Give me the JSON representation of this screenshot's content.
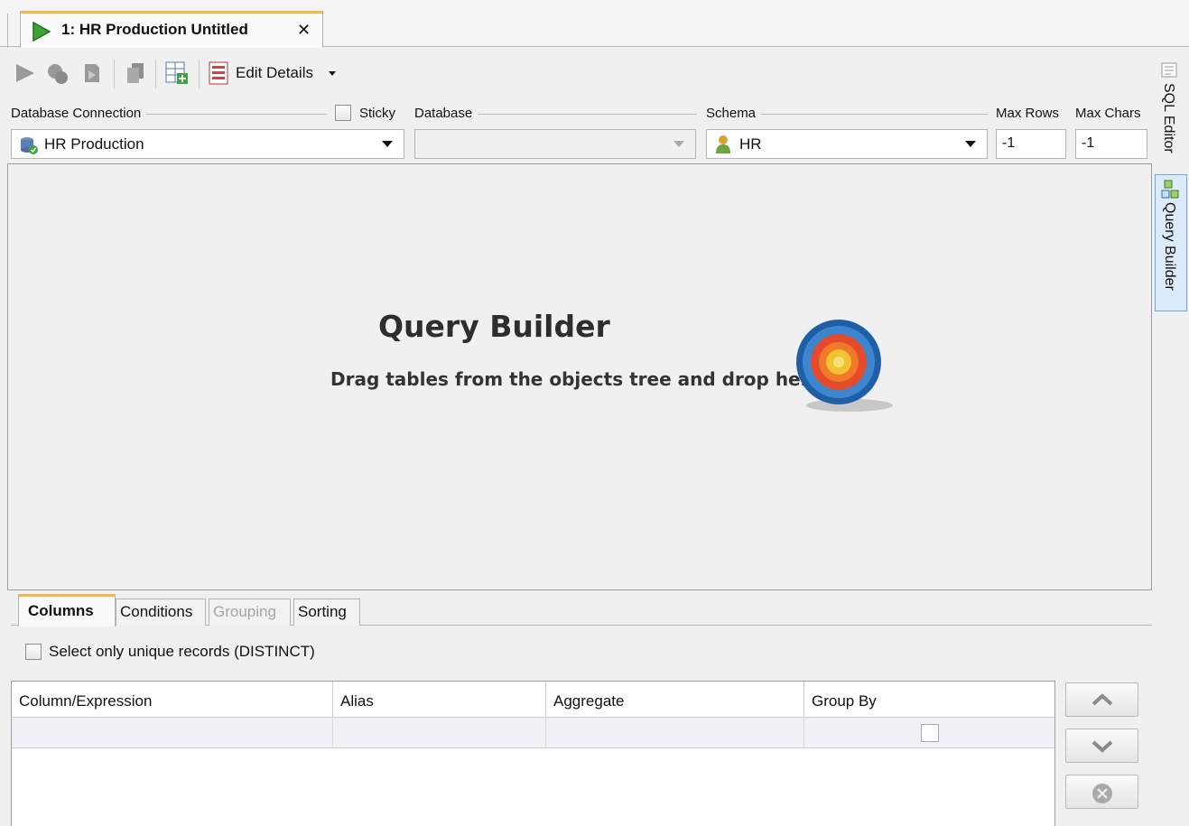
{
  "tab": {
    "title": "1: HR Production Untitled",
    "close_glyph": "✕"
  },
  "toolbar": {
    "edit_details": "Edit Details",
    "icons": [
      "run-icon",
      "debug-icon",
      "explain-plan-icon",
      "copy-icon",
      "add-table-icon",
      "edit-details-icon"
    ]
  },
  "connection": {
    "label": "Database Connection",
    "value": "HR Production",
    "sticky_label": "Sticky",
    "sticky_checked": false
  },
  "database": {
    "label": "Database",
    "value": ""
  },
  "schema": {
    "label": "Schema",
    "value": "HR"
  },
  "limits": {
    "max_rows_label": "Max Rows",
    "max_rows": "-1",
    "max_chars_label": "Max Chars",
    "max_chars": "-1"
  },
  "canvas": {
    "title": "Query Builder",
    "hint": "Drag tables from the objects tree and drop here"
  },
  "side_tabs": [
    {
      "label": "SQL Editor",
      "active": false
    },
    {
      "label": "Query Builder",
      "active": true
    }
  ],
  "bottom_tabs": [
    {
      "label": "Columns",
      "state": "active"
    },
    {
      "label": "Conditions",
      "state": "normal"
    },
    {
      "label": "Grouping",
      "state": "disabled"
    },
    {
      "label": "Sorting",
      "state": "normal"
    }
  ],
  "distinct": {
    "label": "Select only unique records (DISTINCT)",
    "checked": false
  },
  "grid": {
    "headers": [
      "Column/Expression",
      "Alias",
      "Aggregate",
      "Group By"
    ],
    "rows": [
      {
        "column": "",
        "alias": "",
        "aggregate": "",
        "group_by": false
      }
    ]
  },
  "colors": {
    "active_tab_accent": "#f2b84b",
    "side_tab_active_bg": "#dcebfa",
    "side_tab_active_border": "#6ea6dd",
    "canvas_bg": "#f0f0f0"
  }
}
